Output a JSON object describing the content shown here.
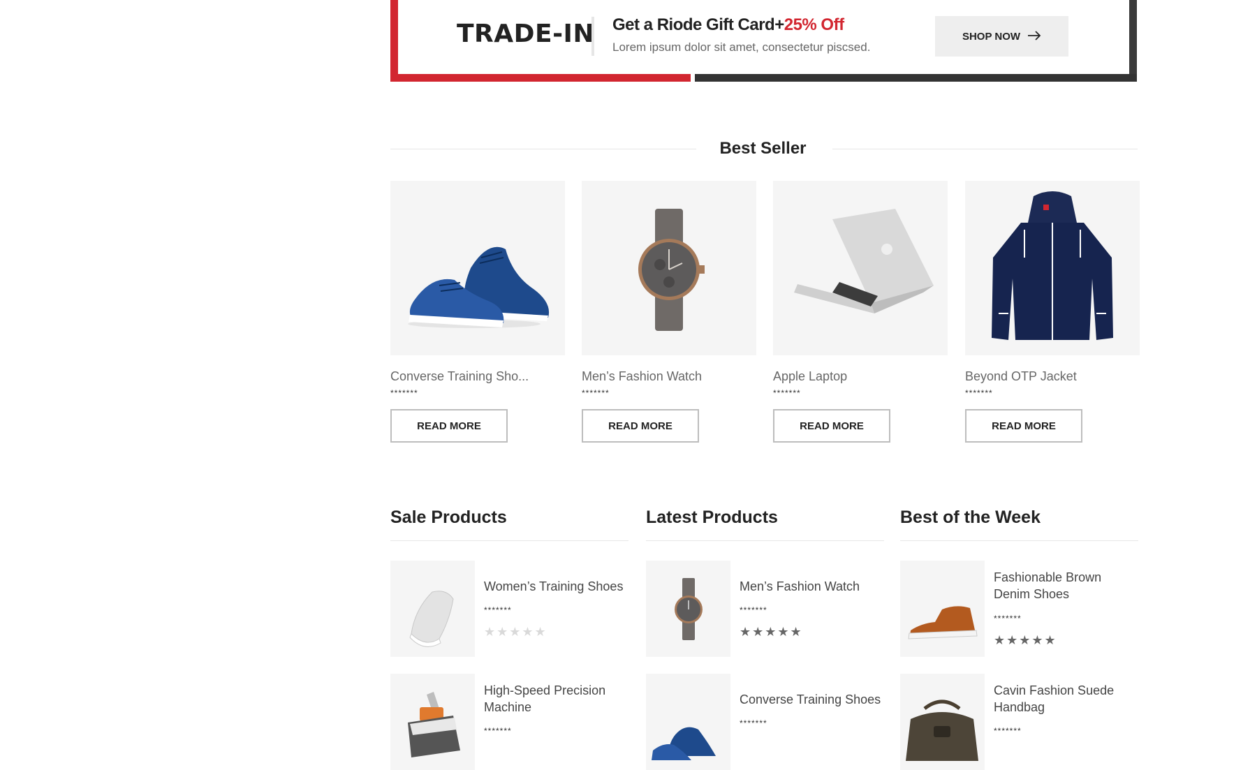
{
  "banner": {
    "title": "TRADE-IN",
    "gift_text": "Get a Riode Gift Card+",
    "gift_highlight": "25% Off",
    "subtitle": "Lorem ipsum dolor sit amet, consectetur piscsed.",
    "button_label": "SHOP NOW",
    "button_icon": "arrow-right-icon",
    "colors": {
      "red": "#d22630",
      "dark": "#333333"
    }
  },
  "best_seller": {
    "title": "Best Seller",
    "products": [
      {
        "name": "Converse Training Sho...",
        "image": "blue-sneakers",
        "stars": "*******",
        "button": "READ MORE"
      },
      {
        "name": "Men’s Fashion Watch",
        "image": "watch",
        "stars": "*******",
        "button": "READ MORE"
      },
      {
        "name": "Apple Laptop",
        "image": "laptop",
        "stars": "*******",
        "button": "READ MORE"
      },
      {
        "name": "Beyond OTP Jacket",
        "image": "jacket",
        "stars": "*******",
        "button": "READ MORE"
      }
    ]
  },
  "lists": [
    {
      "title": "Sale Products",
      "items": [
        {
          "name": "Women’s Training Shoes",
          "image": "white-sneaker",
          "stars": "*******",
          "rating": "★★★★★",
          "rating_color": "#d9d9d9"
        },
        {
          "name": "High-Speed Precision Machine",
          "image": "machine",
          "stars": "*******"
        }
      ]
    },
    {
      "title": "Latest Products",
      "items": [
        {
          "name": "Men’s Fashion Watch",
          "image": "watch",
          "stars": "*******",
          "rating": "★★★★★",
          "rating_color": "#666666"
        },
        {
          "name": "Converse Training Shoes",
          "image": "blue-sneakers",
          "stars": "*******"
        }
      ]
    },
    {
      "title": "Best of the Week",
      "items": [
        {
          "name": "Fashionable Brown Denim Shoes",
          "image": "brown-shoe",
          "stars": "*******",
          "rating": "★★★★★",
          "rating_color": "#666666"
        },
        {
          "name": "Cavin Fashion Suede Handbag",
          "image": "handbag",
          "stars": "*******"
        }
      ]
    }
  ]
}
